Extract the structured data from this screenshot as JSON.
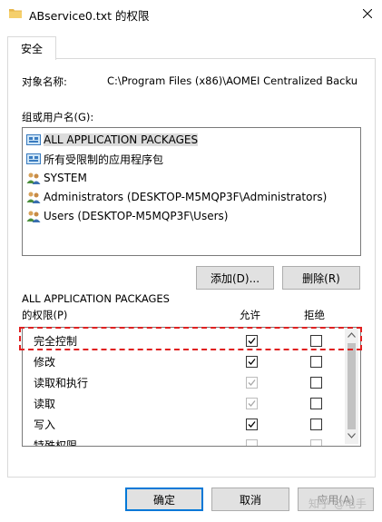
{
  "window": {
    "title": "ABservice0.txt 的权限"
  },
  "tabs": [
    {
      "label": "安全"
    }
  ],
  "object_name": {
    "label": "对象名称:",
    "value": "C:\\Program Files (x86)\\AOMEI Centralized Backu"
  },
  "groups": {
    "label": "组或用户名(G):",
    "items": [
      {
        "label": "ALL APPLICATION PACKAGES",
        "icon": "app-packages-icon",
        "selected": true
      },
      {
        "label": "所有受限制的应用程序包",
        "icon": "app-packages-icon",
        "selected": false
      },
      {
        "label": "SYSTEM",
        "icon": "users-icon",
        "selected": false
      },
      {
        "label": "Administrators (DESKTOP-M5MQP3F\\Administrators)",
        "icon": "users-icon",
        "selected": false
      },
      {
        "label": "Users (DESKTOP-M5MQP3F\\Users)",
        "icon": "users-icon",
        "selected": false
      }
    ]
  },
  "buttons": {
    "add": "添加(D)...",
    "remove": "删除(R)",
    "ok": "确定",
    "cancel": "取消",
    "apply": "应用(A)"
  },
  "permissions": {
    "title": "ALL APPLICATION PACKAGES",
    "label": "的权限(P)",
    "allow_header": "允许",
    "deny_header": "拒绝",
    "rows": [
      {
        "name": "完全控制",
        "allow": true,
        "allow_disabled": false,
        "deny": false
      },
      {
        "name": "修改",
        "allow": true,
        "allow_disabled": false,
        "deny": false
      },
      {
        "name": "读取和执行",
        "allow": true,
        "allow_disabled": true,
        "deny": false
      },
      {
        "name": "读取",
        "allow": true,
        "allow_disabled": true,
        "deny": false
      },
      {
        "name": "写入",
        "allow": true,
        "allow_disabled": false,
        "deny": false
      },
      {
        "name": "特殊权限",
        "allow": false,
        "allow_disabled": true,
        "deny": false
      }
    ]
  },
  "watermark": "知乎 @电手",
  "colors": {
    "highlight_dashed": "#e02020",
    "primary_border": "#0078d7",
    "selection": "#dcdcdc"
  }
}
